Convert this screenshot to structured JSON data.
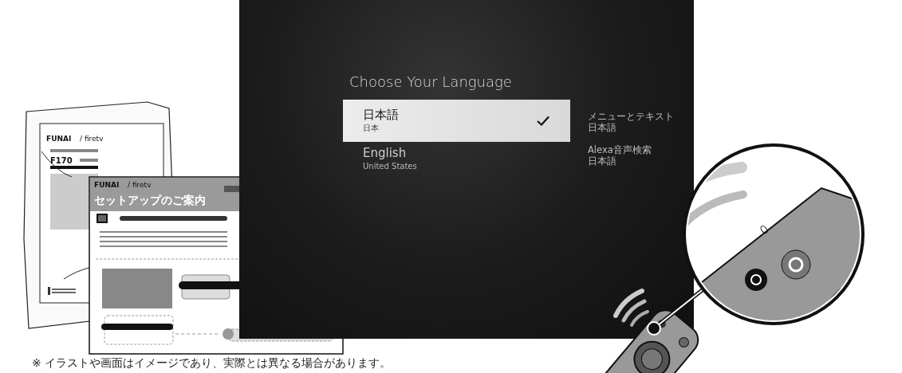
{
  "screen": {
    "title": "Choose Your Language",
    "languages": [
      {
        "name": "日本語",
        "region": "日本",
        "selected": true
      },
      {
        "name": "English",
        "region": "United States",
        "selected": false
      }
    ],
    "settings": [
      {
        "label": "メニューとテキスト",
        "value": "日本語"
      },
      {
        "label": "Alexa音声検索",
        "value": "日本語"
      }
    ]
  },
  "manuals": [
    {
      "kind": "guide",
      "brand": "FUNAI",
      "logo": "/ firetv",
      "model": "F170"
    },
    {
      "kind": "setup",
      "brand": "FUNAI",
      "logo": "/ firetv",
      "title": "セットアップのご案内"
    }
  ],
  "note": "※ イラストや画面はイメージであり、実際とは異なる場合があります。"
}
